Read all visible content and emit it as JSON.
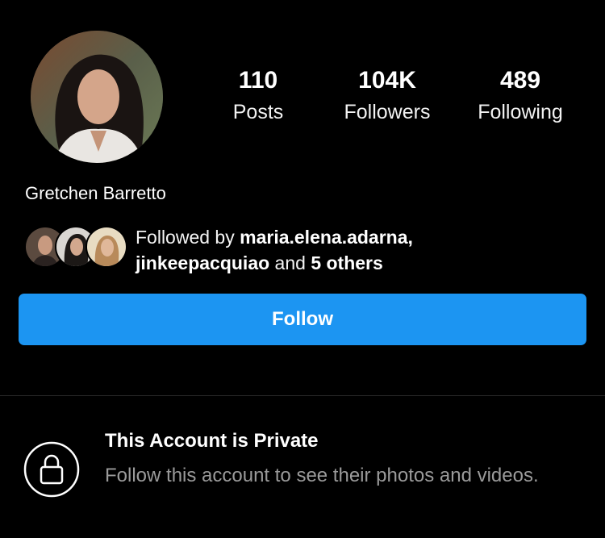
{
  "profile": {
    "name": "Gretchen Barretto",
    "stats": {
      "posts": {
        "value": "110",
        "label": "Posts"
      },
      "followers": {
        "value": "104K",
        "label": "Followers"
      },
      "following": {
        "value": "489",
        "label": "Following"
      }
    }
  },
  "mutual": {
    "prefix": "Followed by ",
    "user1": "maria.elena.adarna",
    "comma": ",",
    "user2": "jinkeepacquiao",
    "middle": " and ",
    "others": "5 others"
  },
  "follow_button": {
    "label": "Follow"
  },
  "private": {
    "title": "This Account is Private",
    "description": "Follow this account to see their photos and videos."
  },
  "colors": {
    "background": "#000000",
    "accent": "#1c95f2",
    "secondary_text": "#9a9a9a",
    "divider": "#262626"
  },
  "icons": {
    "lock": "lock-icon"
  }
}
